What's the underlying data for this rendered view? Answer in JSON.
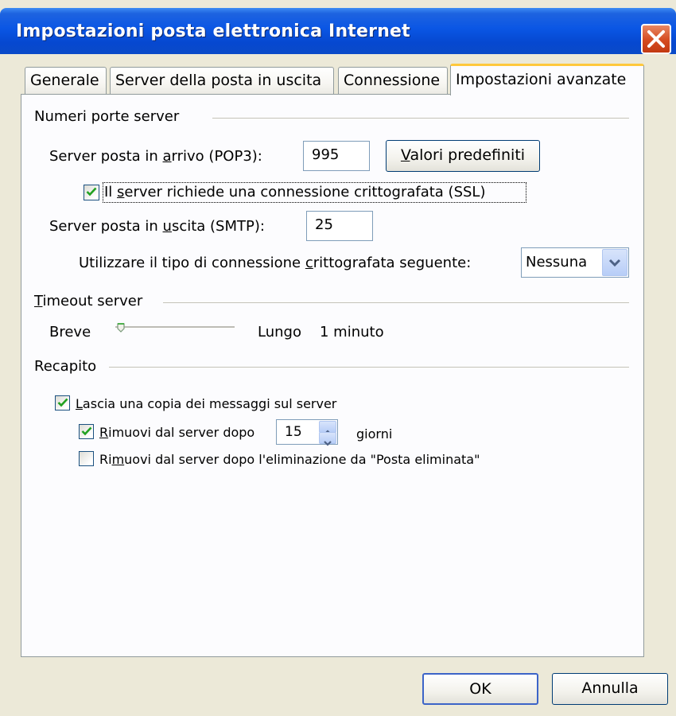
{
  "window": {
    "title": "Impostazioni posta elettronica Internet",
    "close_icon": "close-icon"
  },
  "tabs": [
    {
      "label": "Generale",
      "active": false
    },
    {
      "label": "Server della posta in uscita",
      "active": false
    },
    {
      "label": "Connessione",
      "active": false
    },
    {
      "label": "Impostazioni avanzate",
      "active": true
    }
  ],
  "ports": {
    "group_label": "Numeri porte server",
    "incoming_label_pre": "Server posta in ",
    "incoming_label_u": "a",
    "incoming_label_post": "rrivo (POP3):",
    "incoming_value": "995",
    "defaults_button_u": "V",
    "defaults_button_rest": "alori predefiniti",
    "ssl_checkbox_pre": "Il ",
    "ssl_checkbox_u": "s",
    "ssl_checkbox_post": "erver richiede una connessione crittografata (SSL)",
    "ssl_checked": true,
    "outgoing_label_pre": "Server posta in ",
    "outgoing_label_u": "u",
    "outgoing_label_post": "scita (SMTP):",
    "outgoing_value": "25",
    "encryption_label_pre": "Utilizzare il tipo di connessione ",
    "encryption_label_u": "c",
    "encryption_label_post": "rittografata seguente:",
    "encryption_value": "Nessuna"
  },
  "timeout": {
    "group_label_u": "T",
    "group_label_rest": "imeout server",
    "short_label": "Breve",
    "long_label": "Lungo",
    "value_text": "1 minuto",
    "level": 0.0
  },
  "delivery": {
    "group_label": "Recapito",
    "leave_copy_u": "L",
    "leave_copy_rest": "ascia una copia dei messaggi sul server",
    "leave_copy_checked": true,
    "remove_after_u": "R",
    "remove_after_rest": "imuovi dal server dopo",
    "remove_after_checked": true,
    "days_value": "15",
    "days_label": "giorni",
    "remove_deleted_pre": "Ri",
    "remove_deleted_u": "m",
    "remove_deleted_post": "uovi dal server dopo l'eliminazione da \"Posta eliminata\"",
    "remove_deleted_checked": false
  },
  "footer": {
    "ok_label": "OK",
    "cancel_label": "Annulla"
  },
  "colors": {
    "titlebar": "#0a56e4",
    "dialog_bg": "#ece9d8",
    "check_green": "#21a121",
    "active_tab_accent": "#ffc83c"
  }
}
